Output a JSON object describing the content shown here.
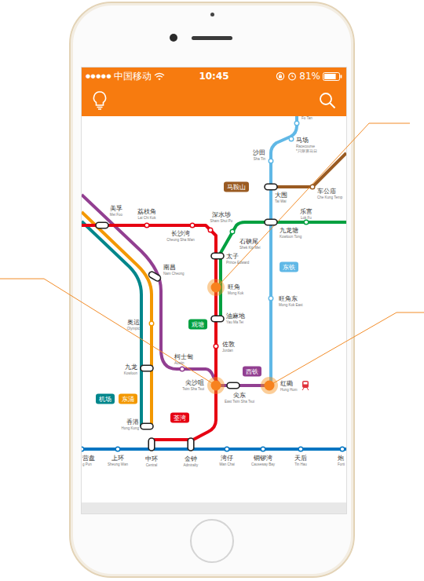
{
  "status_bar": {
    "signal": "●●●●●",
    "carrier": "中国移动",
    "time": "10:45",
    "battery": "81%",
    "battery_level": 0.81
  },
  "lines": [
    {
      "color": "#923f91"
    },
    {
      "color": "#00868b"
    },
    {
      "color": "#f39800"
    },
    {
      "color": "#0075c2"
    },
    {
      "color": "#9a5b22"
    },
    {
      "color": "#60b8e6"
    },
    {
      "color": "#00a040"
    },
    {
      "color": "#e60012"
    }
  ],
  "tags": [
    {
      "label": "马鞍山",
      "color": "#9a5b22"
    },
    {
      "label": "东铁",
      "color": "#60b8e6"
    },
    {
      "label": "观塘",
      "color": "#00a040"
    },
    {
      "label": "西铁",
      "color": "#923f91"
    },
    {
      "label": "荃湾",
      "color": "#e60012"
    },
    {
      "label": "机场",
      "color": "#00868b"
    },
    {
      "label": "东涌",
      "color": "#f39800"
    }
  ],
  "stations": [
    {
      "name": "美孚",
      "english": "Mei Foo",
      "kind": "interchange",
      "highlighted": false
    },
    {
      "name": "荔枝角",
      "english": "Lai Chi Kok",
      "kind": "stop",
      "color": "#e60012",
      "highlighted": false
    },
    {
      "name": "长沙湾",
      "english": "Cheung Sha Wan",
      "kind": "stop",
      "color": "#e60012",
      "highlighted": false
    },
    {
      "name": "深水埗",
      "english": "Sham Shui Po",
      "kind": "stop",
      "color": "#e60012",
      "highlighted": false
    },
    {
      "name": "石硖尾",
      "english": "Shek Kip Mei",
      "kind": "stop",
      "color": "#00a040",
      "highlighted": false
    },
    {
      "name": "太子",
      "english": "Prince Edward",
      "kind": "interchange",
      "highlighted": false
    },
    {
      "name": "旺角",
      "english": "Mong Kok",
      "kind": "highlight",
      "highlighted": true
    },
    {
      "name": "油麻地",
      "english": "Yau Ma Tei",
      "kind": "interchange",
      "highlighted": false
    },
    {
      "name": "佐敦",
      "english": "Jordan",
      "kind": "stop",
      "color": "#e60012",
      "highlighted": false
    },
    {
      "name": "尖沙咀",
      "english": "Tsim Sha Tsui",
      "kind": "highlight",
      "highlighted": true
    },
    {
      "name": "尖东",
      "english": "East Tsim Sha Tsui",
      "kind": "interchange",
      "highlighted": false
    },
    {
      "name": "红磡",
      "english": "Hung Hom",
      "kind": "highlight",
      "highlighted": true
    },
    {
      "name": "旺角东",
      "english": "Mong Kok East",
      "kind": "stop",
      "color": "#60b8e6",
      "highlighted": false
    },
    {
      "name": "九龙塘",
      "english": "Kowloon Tong",
      "kind": "interchange",
      "highlighted": false
    },
    {
      "name": "乐富",
      "english": "Lok Fu",
      "kind": "stop",
      "color": "#00a040",
      "highlighted": false
    },
    {
      "name": "大围",
      "english": "Tai Wai",
      "kind": "interchange",
      "highlighted": false
    },
    {
      "name": "车公庙",
      "english": "Che Kung Temp",
      "kind": "stop",
      "color": "#9a5b22",
      "highlighted": false
    },
    {
      "name": "沙田",
      "english": "Sha Tin",
      "kind": "stop",
      "color": "#60b8e6",
      "highlighted": false
    },
    {
      "name": "马场",
      "english": "Racecourse",
      "note": "*只限赛马日",
      "kind": "stop",
      "color": "#60b8e6",
      "highlighted": false
    },
    {
      "name": "",
      "english": "Fo Tan",
      "kind": "stop",
      "color": "#60b8e6",
      "highlighted": false
    },
    {
      "name": "南昌",
      "english": "Nam Cheong",
      "kind": "interchange",
      "highlighted": false
    },
    {
      "name": "奥运",
      "english": "Olympic",
      "kind": "stop",
      "color": "#f39800",
      "highlighted": false
    },
    {
      "name": "九龙",
      "english": "Kowloon",
      "kind": "interchange",
      "highlighted": false
    },
    {
      "name": "香港",
      "english": "Hong Kong",
      "kind": "interchange",
      "highlighted": false
    },
    {
      "name": "柯士甸",
      "english": "Austin",
      "kind": "stop",
      "color": "#923f91",
      "highlighted": false
    },
    {
      "name": "营盘",
      "english": "g Pun",
      "kind": "stop",
      "color": "#0075c2",
      "highlighted": false
    },
    {
      "name": "上环",
      "english": "Sheung Wan",
      "kind": "stop",
      "color": "#0075c2",
      "highlighted": false
    },
    {
      "name": "中环",
      "english": "Central",
      "kind": "interchange",
      "highlighted": false
    },
    {
      "name": "金钟",
      "english": "Admiralty",
      "kind": "interchange",
      "highlighted": false
    },
    {
      "name": "湾仔",
      "english": "Wan Chai",
      "kind": "stop",
      "color": "#0075c2",
      "highlighted": false
    },
    {
      "name": "铜锣湾",
      "english": "Causeway Bay",
      "kind": "stop",
      "color": "#0075c2",
      "highlighted": false
    },
    {
      "name": "天后",
      "english": "Tin Hau",
      "kind": "stop",
      "color": "#0075c2",
      "highlighted": false
    },
    {
      "name": "炮",
      "english": "Forti",
      "kind": "stop",
      "color": "#0075c2",
      "highlighted": false
    }
  ]
}
